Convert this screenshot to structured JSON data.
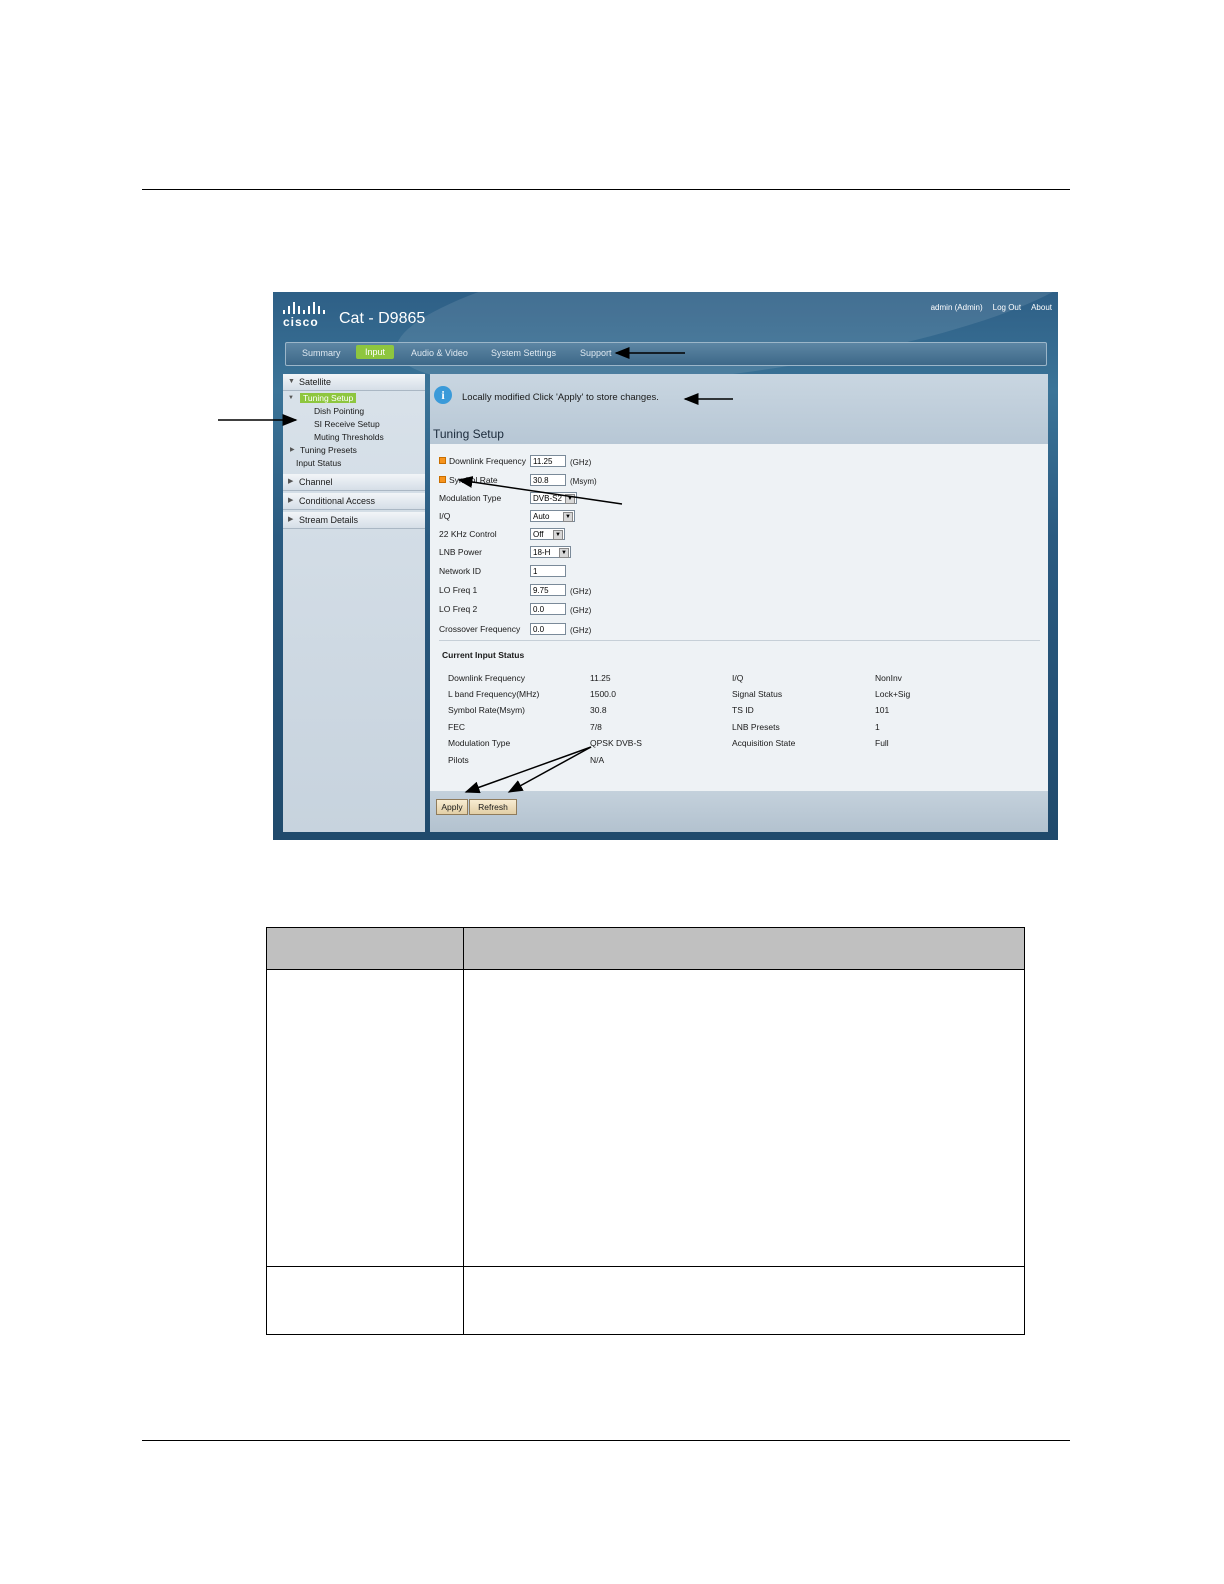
{
  "app": {
    "brand_word": "cisco",
    "title": "Cat - D9865",
    "user": "admin (Admin)",
    "logout": "Log Out",
    "about": "About"
  },
  "nav": {
    "tabs": [
      "Summary",
      "Input",
      "Audio & Video",
      "System Settings",
      "Support"
    ],
    "active": "Input"
  },
  "sidebar": {
    "satellite": "Satellite",
    "tuning_setup": "Tuning Setup",
    "dish_pointing": "Dish Pointing",
    "si_receive_setup": "SI Receive Setup",
    "muting_thresholds": "Muting Thresholds",
    "tuning_presets": "Tuning Presets",
    "input_status": "Input Status",
    "channel": "Channel",
    "conditional_access": "Conditional Access",
    "stream_details": "Stream Details"
  },
  "notice": "Locally modified Click 'Apply' to store changes.",
  "section_title": "Tuning Setup",
  "form": {
    "downlink_label": "Downlink Frequency",
    "downlink_value": "11.25",
    "downlink_unit": "(GHz)",
    "symbol_label": "Symbol Rate",
    "symbol_value": "30.8",
    "symbol_unit": "(Msym)",
    "modulation_label": "Modulation Type",
    "modulation_value": "DVB-S2",
    "iq_label": "I/Q",
    "iq_value": "Auto",
    "khz_label": "22 KHz Control",
    "khz_value": "Off",
    "lnb_label": "LNB Power",
    "lnb_value": "18-H",
    "network_label": "Network ID",
    "network_value": "1",
    "lo1_label": "LO Freq 1",
    "lo1_value": "9.75",
    "lo1_unit": "(GHz)",
    "lo2_label": "LO Freq 2",
    "lo2_value": "0.0",
    "lo2_unit": "(GHz)",
    "crossover_label": "Crossover Frequency",
    "crossover_value": "0.0",
    "crossover_unit": "(GHz)"
  },
  "status": {
    "title": "Current Input Status",
    "left": [
      {
        "label": "Downlink Frequency",
        "value": "11.25"
      },
      {
        "label": "L band Frequency(MHz)",
        "value": "1500.0"
      },
      {
        "label": "Symbol Rate(Msym)",
        "value": "30.8"
      },
      {
        "label": "FEC",
        "value": "7/8"
      },
      {
        "label": "Modulation Type",
        "value": "QPSK DVB-S"
      },
      {
        "label": "Pilots",
        "value": "N/A"
      }
    ],
    "right": [
      {
        "label": "I/Q",
        "value": "NonInv"
      },
      {
        "label": "Signal Status",
        "value": "Lock+Sig"
      },
      {
        "label": "TS ID",
        "value": "101"
      },
      {
        "label": "LNB Presets",
        "value": "1"
      },
      {
        "label": "Acquisition State",
        "value": "Full"
      }
    ]
  },
  "buttons": {
    "apply": "Apply",
    "refresh": "Refresh"
  },
  "colors": {
    "active_tab": "#8ec63f",
    "required_marker": "#f7941d",
    "info_icon": "#3a9ad9",
    "table_header": "#c0c0c0"
  }
}
